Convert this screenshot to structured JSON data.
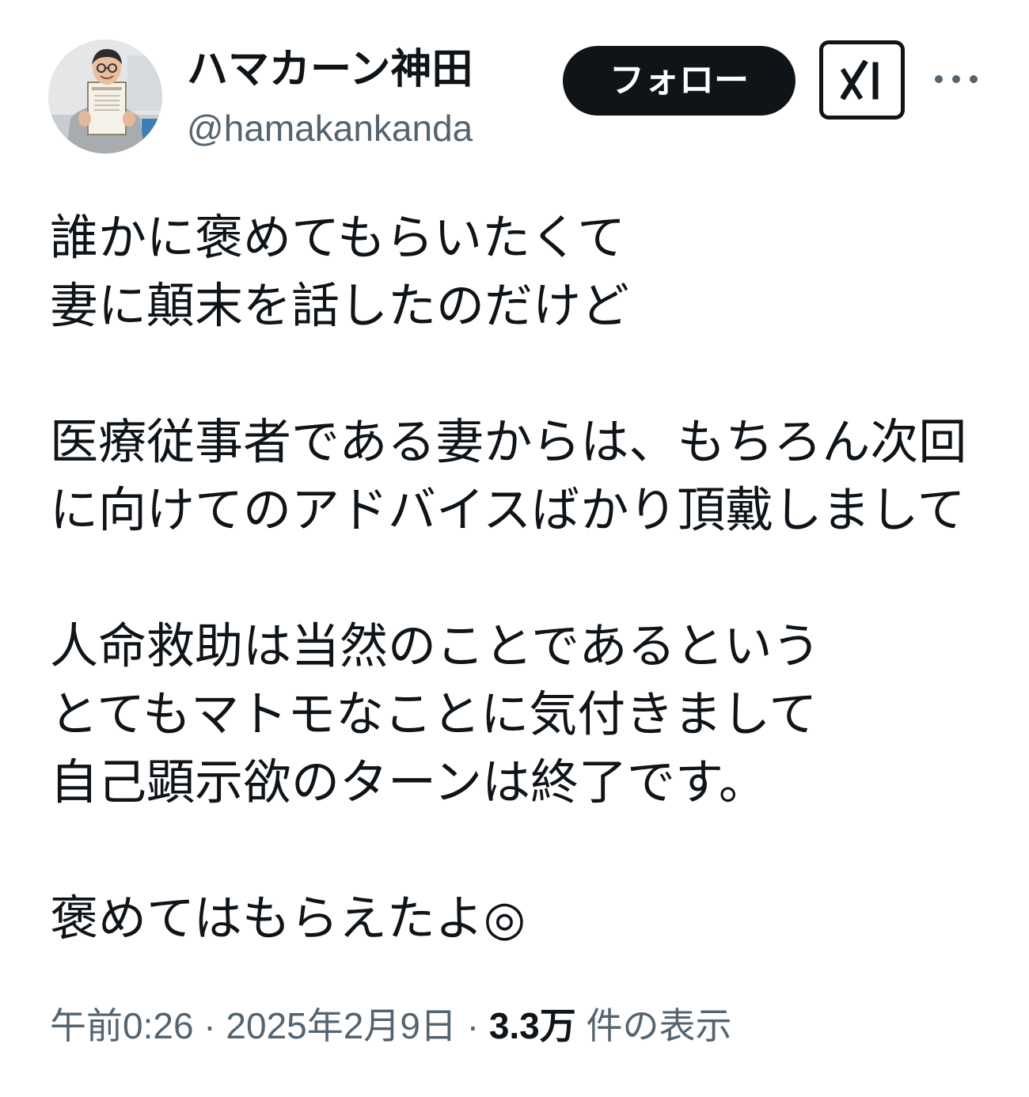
{
  "author": {
    "display_name": "ハマカーン神田",
    "handle": "@hamakankanda",
    "avatar": "avatar-photo-person-holding-certificate"
  },
  "actions": {
    "follow_label": "フォロー",
    "grok_icon": "grok-icon",
    "more_icon": "more-horizontal-icon"
  },
  "tweet": {
    "lines": [
      "誰かに褒めてもらいたくて",
      "妻に顛末を話したのだけど",
      "",
      "医療従事者である妻からは、もちろん次回",
      "に向けてのアドバイスばかり頂戴しまして",
      "",
      "人命救助は当然のことであるという",
      "とてもマトモなことに気付きまして",
      "自己顕示欲のターンは終了です。",
      "",
      "褒めてはもらえたよ◎"
    ]
  },
  "meta": {
    "time": "午前0:26",
    "separator": " · ",
    "date": "2025年2月9日",
    "views_count": "3.3万",
    "views_label": " 件の表示"
  },
  "colors": {
    "text_primary": "#0f1419",
    "text_secondary": "#536471",
    "follow_bg": "#0f1419",
    "follow_text": "#ffffff"
  }
}
